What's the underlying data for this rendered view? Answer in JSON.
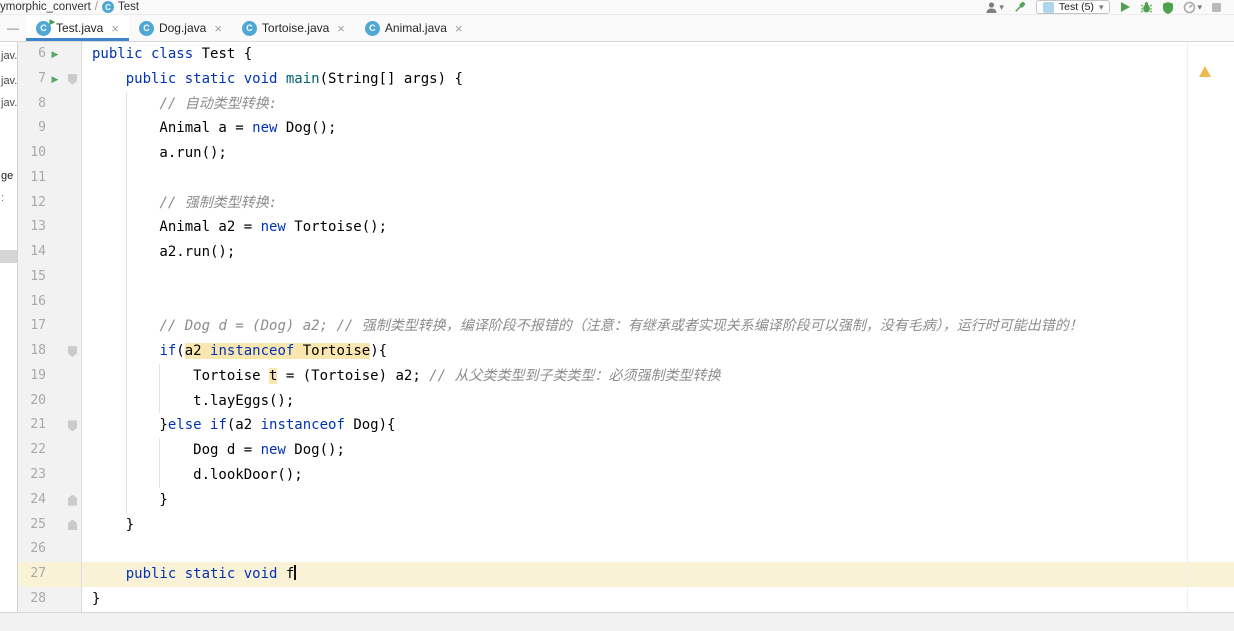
{
  "breadcrumb": {
    "project_path": "ymorphic_convert",
    "separator": "/",
    "class_icon_letter": "C",
    "class_name": "Test"
  },
  "toolbar": {
    "run_config_label": "Test (5)",
    "icons": [
      "user",
      "build-hammer",
      "run-config-class",
      "run",
      "debug",
      "run-with-coverage",
      "profiler",
      "stop"
    ]
  },
  "icons": {
    "close": "×",
    "hide": "—",
    "chevron_down": "▾",
    "run_arrow": "▶",
    "run_overlay": "▶",
    "warning_mark": "!"
  },
  "tabs": [
    {
      "label": "Test.java",
      "icon_letter": "C",
      "active": true,
      "runnable": true
    },
    {
      "label": "Dog.java",
      "icon_letter": "C",
      "active": false,
      "runnable": false
    },
    {
      "label": "Tortoise.java",
      "icon_letter": "C",
      "active": false,
      "runnable": false
    },
    {
      "label": "Animal.java",
      "icon_letter": "C",
      "active": false,
      "runnable": false
    }
  ],
  "sidebar": {
    "fragments": [
      "jav.",
      "jav.",
      "jav.",
      "ge",
      ":"
    ]
  },
  "editor": {
    "lines": [
      {
        "num": 6,
        "run": true,
        "fold": null,
        "caret": false,
        "guides": [],
        "segs": [
          {
            "c": "kw",
            "s": "public class"
          },
          {
            "c": "p",
            "s": " Test {"
          }
        ]
      },
      {
        "num": 7,
        "run": true,
        "fold": "down",
        "caret": false,
        "guides": [],
        "segs": [
          {
            "c": "p",
            "s": "    "
          },
          {
            "c": "kw",
            "s": "public static void"
          },
          {
            "c": "p",
            "s": " "
          },
          {
            "c": "m",
            "s": "main"
          },
          {
            "c": "p",
            "s": "(String[] args) {"
          }
        ]
      },
      {
        "num": 8,
        "run": false,
        "fold": null,
        "caret": false,
        "guides": [
          1
        ],
        "segs": [
          {
            "c": "p",
            "s": "        "
          },
          {
            "c": "cm",
            "s": "// 自动类型转换:"
          }
        ]
      },
      {
        "num": 9,
        "run": false,
        "fold": null,
        "caret": false,
        "guides": [
          1
        ],
        "segs": [
          {
            "c": "p",
            "s": "        Animal a = "
          },
          {
            "c": "kw",
            "s": "new"
          },
          {
            "c": "p",
            "s": " Dog();"
          }
        ]
      },
      {
        "num": 10,
        "run": false,
        "fold": null,
        "caret": false,
        "guides": [
          1
        ],
        "segs": [
          {
            "c": "p",
            "s": "        a.run();"
          }
        ]
      },
      {
        "num": 11,
        "run": false,
        "fold": null,
        "caret": false,
        "guides": [
          1
        ],
        "segs": []
      },
      {
        "num": 12,
        "run": false,
        "fold": null,
        "caret": false,
        "guides": [
          1
        ],
        "segs": [
          {
            "c": "p",
            "s": "        "
          },
          {
            "c": "cm",
            "s": "// 强制类型转换:"
          }
        ]
      },
      {
        "num": 13,
        "run": false,
        "fold": null,
        "caret": false,
        "guides": [
          1
        ],
        "segs": [
          {
            "c": "p",
            "s": "        Animal a2 = "
          },
          {
            "c": "kw",
            "s": "new"
          },
          {
            "c": "p",
            "s": " Tortoise();"
          }
        ]
      },
      {
        "num": 14,
        "run": false,
        "fold": null,
        "caret": false,
        "guides": [
          1
        ],
        "segs": [
          {
            "c": "p",
            "s": "        a2.run();"
          }
        ]
      },
      {
        "num": 15,
        "run": false,
        "fold": null,
        "caret": false,
        "guides": [
          1
        ],
        "segs": []
      },
      {
        "num": 16,
        "run": false,
        "fold": null,
        "caret": false,
        "guides": [
          1
        ],
        "segs": []
      },
      {
        "num": 17,
        "run": false,
        "fold": null,
        "caret": false,
        "guides": [
          1
        ],
        "segs": [
          {
            "c": "p",
            "s": "        "
          },
          {
            "c": "cm",
            "s": "// Dog d = (Dog) a2; // 强制类型转换，编译阶段不报错的（注意：有继承或者实现关系编译阶段可以强制，没有毛病），运行时可能出错的！"
          }
        ]
      },
      {
        "num": 18,
        "run": false,
        "fold": "down",
        "caret": false,
        "guides": [
          1
        ],
        "segs": [
          {
            "c": "p",
            "s": "        "
          },
          {
            "c": "kw",
            "s": "if"
          },
          {
            "c": "p",
            "s": "("
          },
          {
            "c": "hl",
            "segs": [
              {
                "c": "p",
                "s": "a2 "
              },
              {
                "c": "kw",
                "s": "instanceof"
              },
              {
                "c": "p",
                "s": " Tortoise"
              }
            ]
          },
          {
            "c": "p",
            "s": "){"
          }
        ]
      },
      {
        "num": 19,
        "run": false,
        "fold": null,
        "caret": false,
        "guides": [
          1,
          2
        ],
        "segs": [
          {
            "c": "p",
            "s": "            Tortoise "
          },
          {
            "c": "hl",
            "segs": [
              {
                "c": "p",
                "s": "t"
              }
            ]
          },
          {
            "c": "p",
            "s": " = (Tortoise) a2; "
          },
          {
            "c": "cm",
            "s": "// 从父类类型到子类类型：必须强制类型转换"
          }
        ]
      },
      {
        "num": 20,
        "run": false,
        "fold": null,
        "caret": false,
        "guides": [
          1,
          2
        ],
        "segs": [
          {
            "c": "p",
            "s": "            t.layEggs();"
          }
        ]
      },
      {
        "num": 21,
        "run": false,
        "fold": "down",
        "caret": false,
        "guides": [
          1
        ],
        "segs": [
          {
            "c": "p",
            "s": "        }"
          },
          {
            "c": "kw",
            "s": "else"
          },
          {
            "c": "p",
            "s": " "
          },
          {
            "c": "kw",
            "s": "if"
          },
          {
            "c": "p",
            "s": "(a2 "
          },
          {
            "c": "kw",
            "s": "instanceof"
          },
          {
            "c": "p",
            "s": " Dog){"
          }
        ]
      },
      {
        "num": 22,
        "run": false,
        "fold": null,
        "caret": false,
        "guides": [
          1,
          2
        ],
        "segs": [
          {
            "c": "p",
            "s": "            Dog d = "
          },
          {
            "c": "kw",
            "s": "new"
          },
          {
            "c": "p",
            "s": " Dog();"
          }
        ]
      },
      {
        "num": 23,
        "run": false,
        "fold": null,
        "caret": false,
        "guides": [
          1,
          2
        ],
        "segs": [
          {
            "c": "p",
            "s": "            d.lookDoor();"
          }
        ]
      },
      {
        "num": 24,
        "run": false,
        "fold": "up",
        "caret": false,
        "guides": [
          1
        ],
        "segs": [
          {
            "c": "p",
            "s": "        }"
          }
        ]
      },
      {
        "num": 25,
        "run": false,
        "fold": "up",
        "caret": false,
        "guides": [],
        "segs": [
          {
            "c": "p",
            "s": "    }"
          }
        ]
      },
      {
        "num": 26,
        "run": false,
        "fold": null,
        "caret": false,
        "guides": [],
        "segs": []
      },
      {
        "num": 27,
        "run": false,
        "fold": null,
        "caret": true,
        "guides": [],
        "segs": [
          {
            "c": "p",
            "s": "    "
          },
          {
            "c": "kw",
            "s": "public static void"
          },
          {
            "c": "p",
            "s": " f"
          }
        ]
      },
      {
        "num": 28,
        "run": false,
        "fold": null,
        "caret": false,
        "guides": [],
        "segs": [
          {
            "c": "p",
            "s": "}"
          }
        ]
      }
    ]
  },
  "statusbar": {
    "text": ""
  },
  "colors": {
    "accent_blue": "#4083C9",
    "keyword": "#0033B3",
    "comment_gray": "#8C8C8C",
    "method_teal": "#00627A",
    "usage_highlight": "#FAE6AF",
    "caret_row": "#FAF2D7",
    "run_green": "#59A869",
    "class_icon_blue": "#4FA7D6",
    "warning_yellow": "#EFBA4C"
  }
}
